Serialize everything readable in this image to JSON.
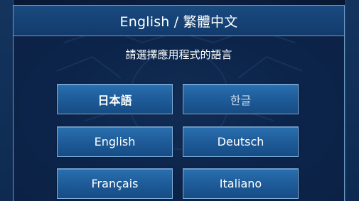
{
  "dialog": {
    "title": "English / 繁體中文",
    "subtitle": "請選擇應用程式的語言"
  },
  "languages": [
    {
      "label": "日本語",
      "row": 0,
      "col": 0,
      "bold": true
    },
    {
      "label": "한글",
      "row": 0,
      "col": 1,
      "dim": true
    },
    {
      "label": "English",
      "row": 1,
      "col": 0
    },
    {
      "label": "Deutsch",
      "row": 1,
      "col": 1
    },
    {
      "label": "Français",
      "row": 2,
      "col": 0
    },
    {
      "label": "Italiano",
      "row": 2,
      "col": 1
    }
  ],
  "colors": {
    "background": "#0c2245",
    "title_bar": "#1a4a80",
    "button": "#1d5a97",
    "border": "#6e9cc8"
  }
}
